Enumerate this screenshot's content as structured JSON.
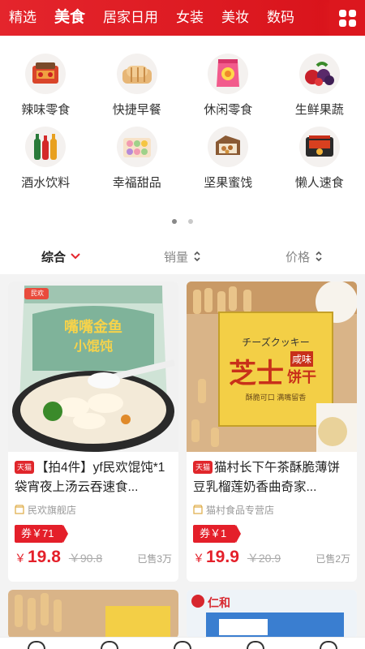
{
  "top_tabs": [
    {
      "label": "精选",
      "active": false
    },
    {
      "label": "美食",
      "active": true
    },
    {
      "label": "居家日用",
      "active": false
    },
    {
      "label": "女装",
      "active": false
    },
    {
      "label": "美妆",
      "active": false
    },
    {
      "label": "数码",
      "active": false
    }
  ],
  "subcategories": [
    {
      "label": "辣味零食",
      "icon": "spicy-snack-icon"
    },
    {
      "label": "快捷早餐",
      "icon": "breakfast-bread-icon"
    },
    {
      "label": "休闲零食",
      "icon": "snack-bag-icon"
    },
    {
      "label": "生鲜果蔬",
      "icon": "fresh-fruit-icon"
    },
    {
      "label": "酒水饮料",
      "icon": "bottles-icon"
    },
    {
      "label": "幸福甜品",
      "icon": "dessert-box-icon"
    },
    {
      "label": "坚果蜜饯",
      "icon": "nuts-icon"
    },
    {
      "label": "懒人速食",
      "icon": "instant-food-icon"
    }
  ],
  "pager": {
    "pages": 2,
    "current": 1
  },
  "sort": [
    {
      "label": "综合",
      "active": true,
      "icon": "chevron-down-icon"
    },
    {
      "label": "销量",
      "active": false,
      "icon": "sort-arrows-icon"
    },
    {
      "label": "价格",
      "active": false,
      "icon": "sort-arrows-icon"
    }
  ],
  "products": [
    {
      "badge": "天猫",
      "title": "【拍4件】yf民欢馄饨*1袋宵夜上汤云吞速食...",
      "shop": "民欢旗舰店",
      "coupon": "券￥71",
      "currency": "￥",
      "price": "19.8",
      "orig_price": "￥90.8",
      "sold": "已售3万",
      "image_text": {
        "brand": "民欢",
        "line1": "嘴嘴金鱼",
        "line2": "小馄饨"
      }
    },
    {
      "badge": "天猫",
      "title": "猫村长下午茶酥脆薄饼豆乳榴莲奶香曲奇家...",
      "shop": "猫村食品专营店",
      "coupon": "券￥1",
      "currency": "￥",
      "price": "19.9",
      "orig_price": "￥20.9",
      "sold": "已售2万",
      "image_text": {
        "jp": "チーズクッキー",
        "big": "芝士",
        "flavor": "咸味",
        "kind": "饼干",
        "sub": "酥脆可口 满嘴留香"
      }
    }
  ],
  "partial_cards": [
    {
      "brand": "仁和"
    }
  ],
  "colors": {
    "brand_red": "#e4252c",
    "price_red": "#e4202a",
    "coupon_red": "#e41f2a"
  }
}
